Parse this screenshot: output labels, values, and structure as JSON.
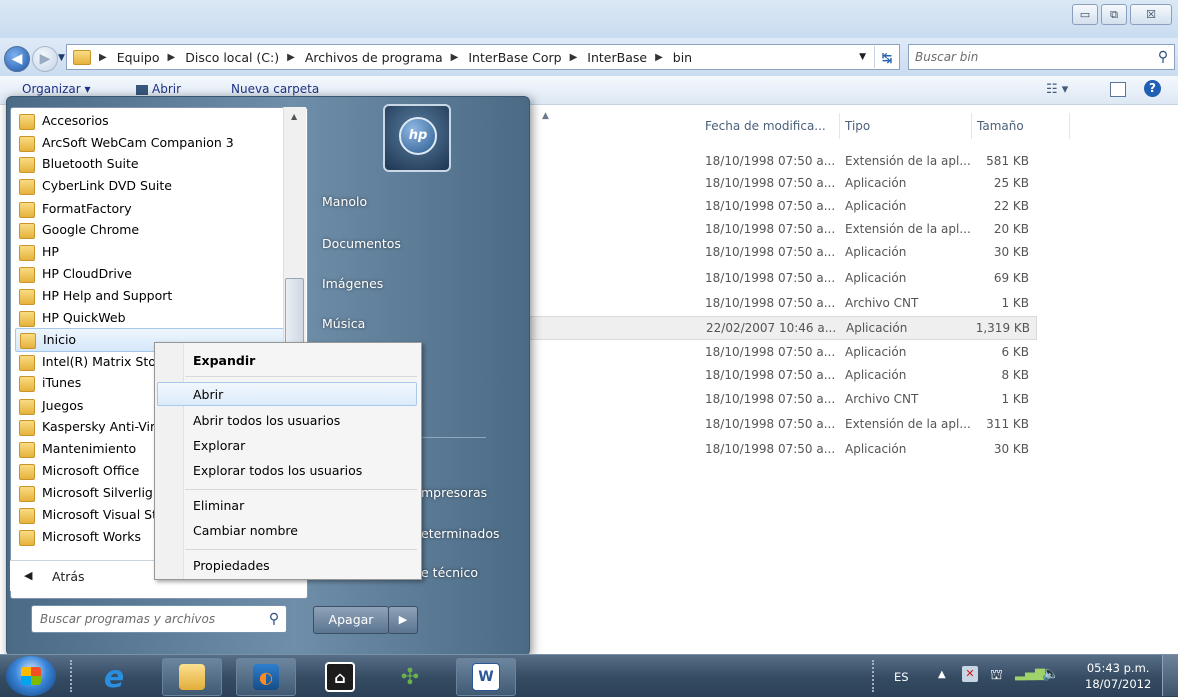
{
  "window": {
    "caption_buttons": {
      "minimize": "▭",
      "maximize": "⧉",
      "close": "☒"
    }
  },
  "address": {
    "crumbs": [
      "Equipo",
      "Disco local (C:)",
      "Archivos de programa",
      "InterBase Corp",
      "InterBase",
      "bin"
    ],
    "search_placeholder": "Buscar bin"
  },
  "toolbar": {
    "organize": "Organizar ▾",
    "open": "Abrir",
    "new_folder": "Nueva carpeta"
  },
  "columns": {
    "date": "Fecha de modifica...",
    "type": "Tipo",
    "size": "Tamaño"
  },
  "files": [
    {
      "date": "18/10/1998 07:50 a...",
      "type": "Extensión de la apl...",
      "size": "581 KB"
    },
    {
      "date": "18/10/1998 07:50 a...",
      "type": "Aplicación",
      "size": "25 KB"
    },
    {
      "date": "18/10/1998 07:50 a...",
      "type": "Aplicación",
      "size": "22 KB"
    },
    {
      "date": "18/10/1998 07:50 a...",
      "type": "Extensión de la apl...",
      "size": "20 KB"
    },
    {
      "date": "18/10/1998 07:50 a...",
      "type": "Aplicación",
      "size": "30 KB"
    },
    {
      "date": "18/10/1998 07:50 a...",
      "type": "Aplicación",
      "size": "69 KB"
    },
    {
      "date": "18/10/1998 07:50 a...",
      "type": "Archivo CNT",
      "size": "1 KB"
    },
    {
      "date": "22/02/2007 10:46 a...",
      "type": "Aplicación",
      "size": "1,319 KB"
    },
    {
      "date": "18/10/1998 07:50 a...",
      "type": "Aplicación",
      "size": "6 KB"
    },
    {
      "date": "18/10/1998 07:50 a...",
      "type": "Aplicación",
      "size": "8 KB"
    },
    {
      "date": "18/10/1998 07:50 a...",
      "type": "Archivo CNT",
      "size": "1 KB"
    },
    {
      "date": "18/10/1998 07:50 a...",
      "type": "Extensión de la apl...",
      "size": "311 KB"
    },
    {
      "date": "18/10/1998 07:50 a...",
      "type": "Aplicación",
      "size": "30 KB"
    }
  ],
  "start_menu": {
    "programs": [
      "Accesorios",
      "ArcSoft WebCam Companion 3",
      "Bluetooth Suite",
      "CyberLink DVD Suite",
      "FormatFactory",
      "Google Chrome",
      "HP",
      "HP CloudDrive",
      "HP Help and Support",
      "HP QuickWeb",
      "Inicio",
      "Intel(R) Matrix Stor",
      "iTunes",
      "Juegos",
      "Kaspersky Anti-Vir",
      "Mantenimiento",
      "Microsoft Office",
      "Microsoft Silverlig",
      "Microsoft Visual St",
      "Microsoft Works"
    ],
    "back": "Atrás",
    "search_placeholder": "Buscar programas y archivos",
    "user_logo": "hp",
    "right_links": [
      "Manolo",
      "Documentos",
      "Imágenes",
      "Música"
    ],
    "right_links_partial": [
      "mpresoras",
      "eterminados",
      "e técnico"
    ],
    "shutdown": "Apagar"
  },
  "context_menu": {
    "items": [
      "Expandir",
      "Abrir",
      "Abrir todos los usuarios",
      "Explorar",
      "Explorar todos los usuarios",
      "Eliminar",
      "Cambiar nombre",
      "Propiedades"
    ]
  },
  "taskbar": {
    "language": "ES",
    "time": "05:43 p.m.",
    "date": "18/07/2012"
  },
  "colors": {
    "accent": "#1e3287",
    "start_menu": "#5f7f9c",
    "taskbar": "#344b62"
  }
}
